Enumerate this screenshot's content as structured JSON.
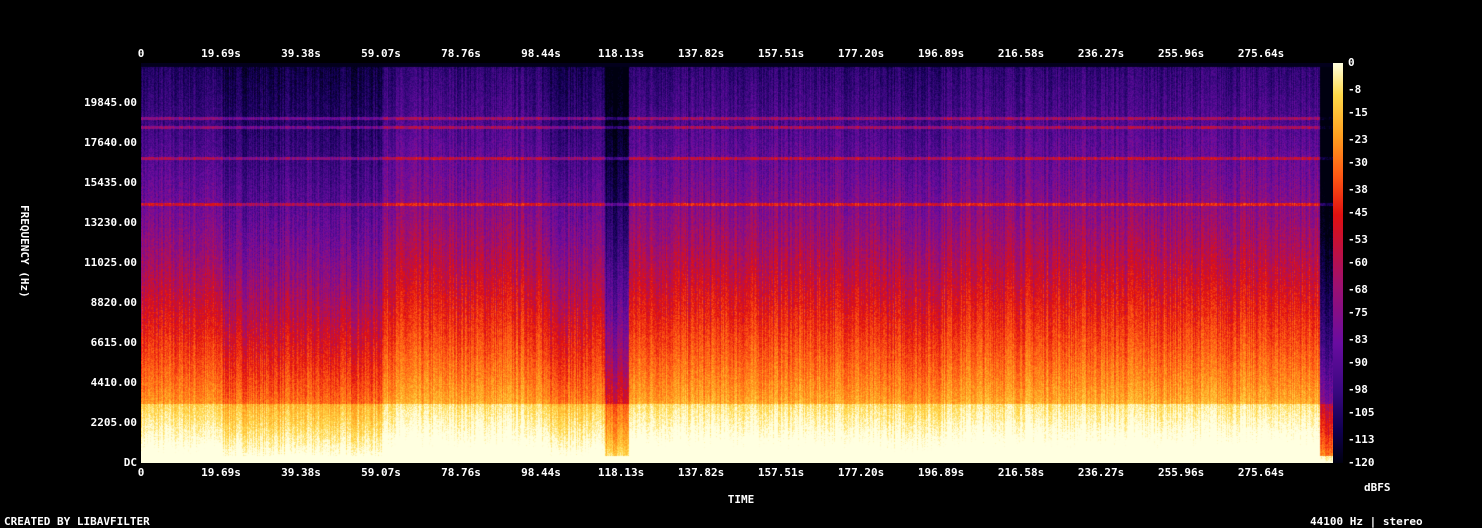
{
  "chart_data": {
    "type": "heatmap",
    "xlabel": "TIME",
    "ylabel": "FREQUENCY (Hz)",
    "x_ticks": [
      "0",
      "19.69s",
      "39.38s",
      "59.07s",
      "78.76s",
      "98.44s",
      "118.13s",
      "137.82s",
      "157.51s",
      "177.20s",
      "196.89s",
      "216.58s",
      "236.27s",
      "255.96s",
      "275.64s"
    ],
    "x_tick_values": [
      0,
      19.69,
      39.38,
      59.07,
      78.76,
      98.44,
      118.13,
      137.82,
      157.51,
      177.2,
      196.89,
      216.58,
      236.27,
      255.96,
      275.64
    ],
    "xlim": [
      0,
      295.3
    ],
    "y_ticks": [
      "DC",
      "2205.00",
      "4410.00",
      "6615.00",
      "8820.00",
      "11025.00",
      "13230.00",
      "15435.00",
      "17640.00",
      "19845.00"
    ],
    "y_tick_values": [
      0,
      2205,
      4410,
      6615,
      8820,
      11025,
      13230,
      15435,
      17640,
      19845
    ],
    "ylim": [
      0,
      22050
    ],
    "colorbar_label": "dBFS",
    "colorbar_ticks": [
      "0",
      "-8",
      "-15",
      "-23",
      "-30",
      "-38",
      "-45",
      "-53",
      "-60",
      "-68",
      "-75",
      "-83",
      "-90",
      "-98",
      "-105",
      "-113",
      "-120"
    ],
    "colorbar_values": [
      0,
      -8,
      -15,
      -23,
      -30,
      -38,
      -45,
      -53,
      -60,
      -68,
      -75,
      -83,
      -90,
      -98,
      -105,
      -113,
      -120
    ],
    "colormap": [
      "#000010",
      "#100050",
      "#3a0880",
      "#6a0ca0",
      "#a0106e",
      "#e01010",
      "#ff5a14",
      "#ffa020",
      "#ffd84a",
      "#ffffe0"
    ],
    "sections": [
      {
        "start": 0,
        "end": 19.69,
        "level": -55
      },
      {
        "start": 19.69,
        "end": 59.07,
        "level": -62
      },
      {
        "start": 59.07,
        "end": 98.44,
        "level": -50
      },
      {
        "start": 98.44,
        "end": 114,
        "level": -58
      },
      {
        "start": 114,
        "end": 120,
        "level": -80
      },
      {
        "start": 120,
        "end": 177.2,
        "level": -50
      },
      {
        "start": 177.2,
        "end": 196.89,
        "level": -53
      },
      {
        "start": 196.89,
        "end": 295.3,
        "level": -49
      }
    ],
    "tone_lines_hz": [
      19000,
      18500,
      16800,
      14300
    ]
  },
  "footer": {
    "created_by": "CREATED BY LIBAVFILTER",
    "format": "44100 Hz | stereo"
  }
}
